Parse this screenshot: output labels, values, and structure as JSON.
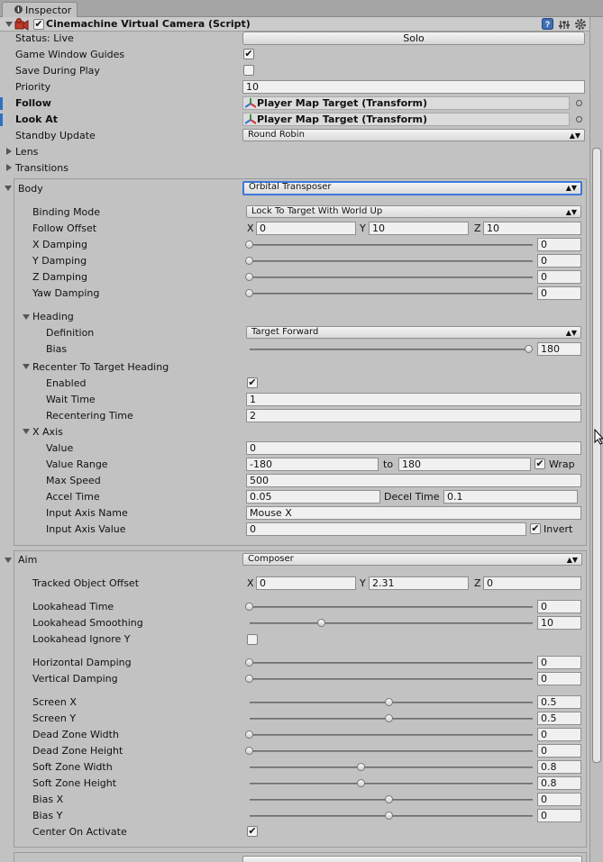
{
  "tab": {
    "label": "Inspector"
  },
  "component": {
    "title": "Cinemachine Virtual Camera (Script)",
    "enabled": true
  },
  "status": {
    "label": "Status: Live",
    "button": "Solo"
  },
  "game_window_guides": {
    "label": "Game Window Guides",
    "checked": true
  },
  "save_during_play": {
    "label": "Save During Play",
    "checked": false
  },
  "priority": {
    "label": "Priority",
    "value": "10"
  },
  "follow": {
    "label": "Follow",
    "value": "Player Map Target (Transform)"
  },
  "look_at": {
    "label": "Look At",
    "value": "Player Map Target (Transform)"
  },
  "standby_update": {
    "label": "Standby Update",
    "value": "Round Robin"
  },
  "lens": {
    "label": "Lens"
  },
  "transitions": {
    "label": "Transitions"
  },
  "body": {
    "label": "Body",
    "value": "Orbital Transposer",
    "binding_mode": {
      "label": "Binding Mode",
      "value": "Lock To Target With World Up"
    },
    "follow_offset": {
      "label": "Follow Offset",
      "x": "0",
      "y": "10",
      "z": "10"
    },
    "x_damping": {
      "label": "X Damping",
      "value": "0"
    },
    "y_damping": {
      "label": "Y Damping",
      "value": "0"
    },
    "z_damping": {
      "label": "Z Damping",
      "value": "0"
    },
    "yaw_damping": {
      "label": "Yaw Damping",
      "value": "0"
    },
    "heading": {
      "label": "Heading",
      "definition": {
        "label": "Definition",
        "value": "Target Forward"
      },
      "bias": {
        "label": "Bias",
        "value": "180"
      }
    },
    "recenter": {
      "label": "Recenter To Target Heading",
      "enabled": {
        "label": "Enabled",
        "checked": true
      },
      "wait_time": {
        "label": "Wait Time",
        "value": "1"
      },
      "recentering_time": {
        "label": "Recentering Time",
        "value": "2"
      }
    },
    "x_axis": {
      "label": "X Axis",
      "value": {
        "label": "Value",
        "value": "0"
      },
      "value_range": {
        "label": "Value Range",
        "min": "-180",
        "to": "to",
        "max": "180",
        "wrap_label": "Wrap",
        "wrap": true
      },
      "max_speed": {
        "label": "Max Speed",
        "value": "500"
      },
      "accel_time": {
        "label": "Accel Time",
        "value": "0.05"
      },
      "decel_time": {
        "label": "Decel Time",
        "value": "0.1"
      },
      "input_axis_name": {
        "label": "Input Axis Name",
        "value": "Mouse X"
      },
      "input_axis_value": {
        "label": "Input Axis Value",
        "value": "0",
        "invert_label": "Invert",
        "invert": true
      }
    }
  },
  "aim": {
    "label": "Aim",
    "value": "Composer",
    "tracked_object_offset": {
      "label": "Tracked Object Offset",
      "x": "0",
      "y": "2.31",
      "z": "0"
    },
    "lookahead_time": {
      "label": "Lookahead Time",
      "value": "0"
    },
    "lookahead_smoothing": {
      "label": "Lookahead Smoothing",
      "value": "10"
    },
    "lookahead_ignore_y": {
      "label": "Lookahead Ignore Y",
      "checked": false
    },
    "horizontal_damping": {
      "label": "Horizontal Damping",
      "value": "0"
    },
    "vertical_damping": {
      "label": "Vertical Damping",
      "value": "0"
    },
    "screen_x": {
      "label": "Screen X",
      "value": "0.5"
    },
    "screen_y": {
      "label": "Screen Y",
      "value": "0.5"
    },
    "dead_zone_width": {
      "label": "Dead Zone Width",
      "value": "0"
    },
    "dead_zone_height": {
      "label": "Dead Zone Height",
      "value": "0"
    },
    "soft_zone_width": {
      "label": "Soft Zone Width",
      "value": "0.8"
    },
    "soft_zone_height": {
      "label": "Soft Zone Height",
      "value": "0.8"
    },
    "bias_x": {
      "label": "Bias X",
      "value": "0"
    },
    "bias_y": {
      "label": "Bias Y",
      "value": "0"
    },
    "center_on_activate": {
      "label": "Center On Activate",
      "checked": true
    }
  },
  "axis_letters": {
    "x": "X",
    "y": "Y",
    "z": "Z"
  },
  "check_glyph": "✔",
  "colors": {
    "accent": "#3d78d9",
    "panel_bg": "#c2c2c2"
  }
}
